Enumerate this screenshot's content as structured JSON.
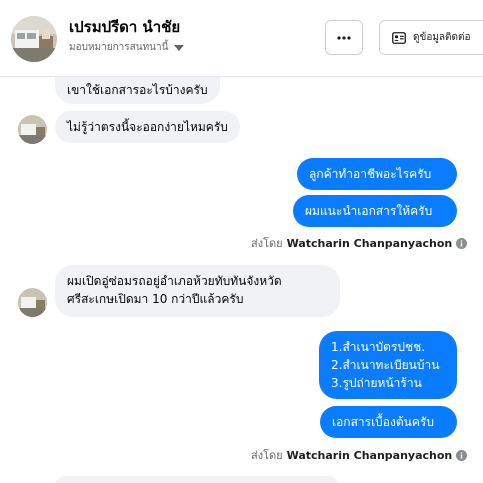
{
  "header": {
    "contact_name": "เปรมปรีดา นำชัย",
    "assign_label": "มอบหมายการสนทนานี้",
    "more_icon": "more-horizontal-icon",
    "contact_button_label": "ดูข้อมูลติดต่อ",
    "contact_icon": "contact-card-icon"
  },
  "messages": [
    {
      "direction": "incoming",
      "text": "เขาใช้เอกสารอะไรบ้างครับ"
    },
    {
      "direction": "incoming",
      "text": "ไม่รู้ว่าตรงนี้จะออกง่ายไหมครับ"
    },
    {
      "direction": "outgoing",
      "text": "ลูกค้าทำอาชีพอะไรครับ"
    },
    {
      "direction": "outgoing",
      "text": "ผมแนะนำเอกสารให้ครับ"
    },
    {
      "direction": "incoming",
      "lines": [
        "ผมเปิดอู่ซ่อมรถอยู่อำเภอห้วยทับทันจังหวัด",
        "ศรีสะเกษเปิดมา 10 กว่าปีแล้วครับ"
      ]
    },
    {
      "direction": "outgoing",
      "lines": [
        "1.สำเนาบัตรปชช.",
        "2.สำเนาทะเบียนบ้าน",
        "3.รูปถ่ายหน้าร้าน"
      ]
    },
    {
      "direction": "outgoing",
      "text": "เอกสารเบื้องต้นครับ"
    }
  ],
  "sent_by": {
    "prefix": "ส่งโดย",
    "name": "Watcharin Chanpanyachon",
    "icon": "info-icon"
  },
  "colors": {
    "outgoing_bubble": "#0a7cff",
    "incoming_bubble": "#f0f2f5",
    "border": "#ccd0d5"
  }
}
